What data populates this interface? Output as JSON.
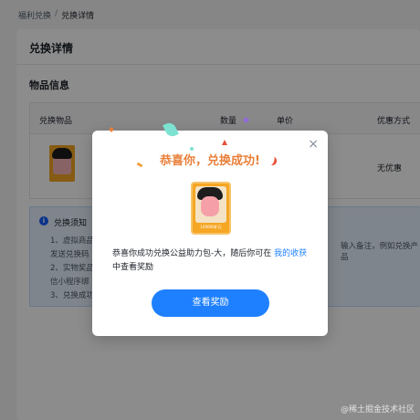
{
  "breadcrumb": {
    "parent": "福利兑换",
    "separator": "/",
    "current": "兑换详情"
  },
  "page": {
    "title": "兑换详情",
    "section_title": "物品信息"
  },
  "table": {
    "headers": {
      "item": "兑换物品",
      "quantity": "数量",
      "unit_price": "单价",
      "discount": "优惠方式"
    },
    "row": {
      "discount": "无优惠"
    }
  },
  "notice": {
    "title": "兑换须知",
    "lines": [
      "1、虚拟商品",
      "发送兑换码",
      "2、实物奖品",
      "信小程序绑",
      "3、兑换成功"
    ],
    "right_text": "输入备注，例如兑换产品"
  },
  "dialog": {
    "title": "恭喜你，兑换成功!",
    "prize_caption": "100000矿石",
    "desc_prefix": "恭喜你成功兑换公益助力包-大，随后你可在",
    "desc_link": "我的收获",
    "desc_suffix": "中查看奖励",
    "button_label": "查看奖励",
    "close_glyph": "×"
  },
  "watermark": "@稀土掘金技术社区",
  "colors": {
    "accent": "#1e80ff",
    "title_orange": "#e8803a"
  }
}
